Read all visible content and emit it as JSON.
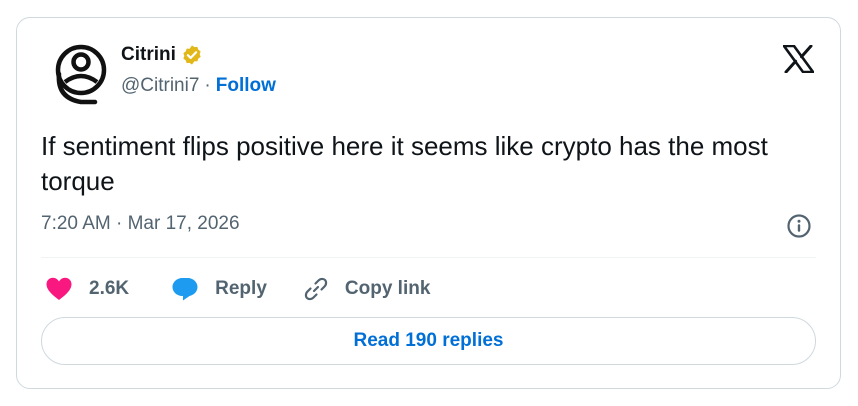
{
  "author": {
    "name": "Citrini",
    "handle": "@Citrini7",
    "separator": "·",
    "follow_label": "Follow",
    "verified_color": "#e2b719"
  },
  "tweet": {
    "text": "If sentiment flips positive here it seems like crypto has the most torque",
    "time": "7:20 AM",
    "separator": "·",
    "date": "Mar 17, 2026"
  },
  "actions": {
    "like_count": "2.6K",
    "reply_label": "Reply",
    "copy_label": "Copy link"
  },
  "read_replies_label": "Read 190 replies",
  "colors": {
    "like": "#f91880",
    "reply": "#1d9bf0",
    "link": "#006fd6",
    "muted": "#536471"
  },
  "icons": [
    "avatar-logo",
    "verified-badge-icon",
    "x-logo-icon",
    "info-icon",
    "heart-icon",
    "reply-bubble-icon",
    "link-icon"
  ]
}
